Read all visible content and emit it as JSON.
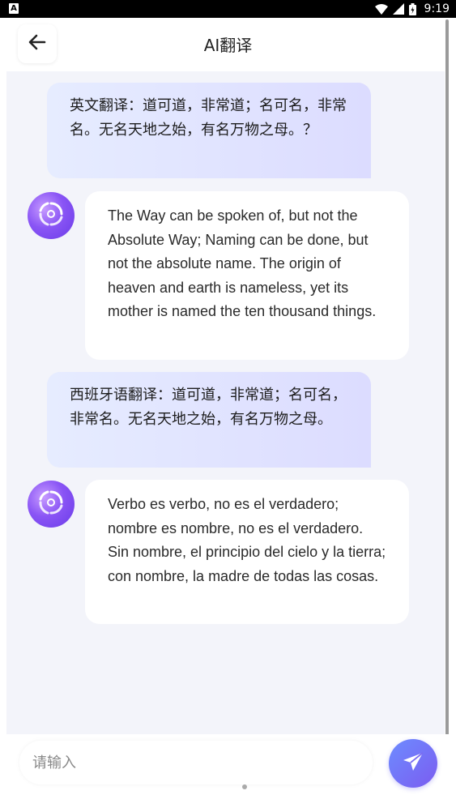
{
  "status_bar": {
    "left_icon_letter": "A",
    "time": "9:19"
  },
  "header": {
    "title": "AI翻译"
  },
  "messages": [
    {
      "role": "user",
      "text": "英文翻译：道可道，非常道；名可名，非常名。无名天地之始，有名万物之母。？"
    },
    {
      "role": "assistant",
      "text": "The Way can be spoken of, but not the Absolute Way; Naming can be done, but not the absolute name. The origin of heaven and earth is nameless, yet its mother is named the ten thousand things."
    },
    {
      "role": "user",
      "text": "西班牙语翻译：道可道，非常道；名可名，非常名。无名天地之始，有名万物之母。"
    },
    {
      "role": "assistant",
      "text": "Verbo es verbo, no es el verdadero; nombre es nombre, no es el verdadero. Sin nombre, el principio del cielo y la tierra; con nombre, la madre de todas las cosas."
    }
  ],
  "input": {
    "placeholder": "请输入",
    "value": ""
  },
  "icons": {
    "back": "arrow-left-icon",
    "send": "paper-plane-icon",
    "avatar": "ai-swirl-icon"
  },
  "colors": {
    "accent": "#7b5cf0",
    "user_bubble_start": "#e6ecff",
    "user_bubble_end": "#dcdcff",
    "chat_background": "#f3f4fa"
  }
}
